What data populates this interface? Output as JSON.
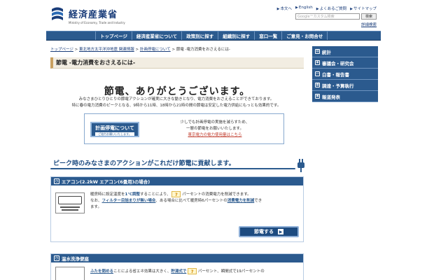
{
  "header": {
    "logo_jp": "経済産業省",
    "logo_en": "Ministry of Economy, Trade and Industry",
    "util_links": [
      "本文へ",
      "English",
      "よくあるご質問",
      "サイトマップ"
    ],
    "search_placeholder": "Google™カスタム検索",
    "search_button": "検索",
    "advanced_search": "詳細検索"
  },
  "nav": {
    "items": [
      "トップページ",
      "経済産業省について",
      "政策別に探す",
      "組織別に探す",
      "窓口一覧",
      "ご意見・お問合せ"
    ]
  },
  "breadcrumb": {
    "items": [
      "トップページ",
      "東北地方太平洋沖地震 関連情報",
      "計画停電について"
    ],
    "current": "節電 -電力消費をおさえるには-"
  },
  "main": {
    "page_title": "節電 -電力消費をおさえるには-",
    "thanks": "節電、ありがとうございます。",
    "intro_line1": "みなさまひとりひとりの節電アクションが確実に大きな動きとなり、電力消費をおさえることができております。",
    "intro_line2": "特に春の電力消費のピークとなる、9時から11時、18時から21時の間の節電は安定した電力供給にもっとも効果的です。",
    "plan_button_title": "計画停電について",
    "plan_button_sub": "ご協力お願いいたします。",
    "plan_text1": "少しでも計画停電の実施を減らすため、",
    "plan_text2": "一層の節電をお願いいたします。",
    "plan_link": "東京電力の電力使用量はこちら",
    "peak_title": "ピーク時のみなさまのアクションがこれだけ節電に貢献します。",
    "section1": {
      "title": "エアコン(2.2kW エアコン(6畳用)の場合)",
      "line1_a": "暖房時に設定温度を",
      "line1_b": "1℃調整",
      "line1_c": "することにより、",
      "line1_q": "?",
      "line1_d": "パーセントの消費電力を削減できます。",
      "line2_a": "なお、",
      "line2_b": "フィルター目詰まりが無い場合",
      "line2_c": "、ある場合に比べて暖房時6パーセントの",
      "line2_d": "消費電力を削減",
      "line2_e": "でき",
      "line3": "ます。",
      "save_button": "節電する"
    },
    "section2": {
      "title": "温水洗浄便座",
      "line1_a": "ふたを閉める",
      "line1_b": "ことによる省エネ効果は大きく、",
      "line1_c": "貯湯式で",
      "line1_q": "?",
      "line1_d": "パーセント、瞬間式で19パーセントの"
    }
  },
  "sidebar": {
    "items": [
      "統計",
      "審議会・研究会",
      "白書・報告書",
      "調達・予算執行",
      "報道発表"
    ]
  },
  "colors": {
    "nav_blue": "#2b5a8e",
    "title_bar": "#f2ede2",
    "accent_gold": "#c9a060",
    "link_red": "#c03a2b"
  }
}
